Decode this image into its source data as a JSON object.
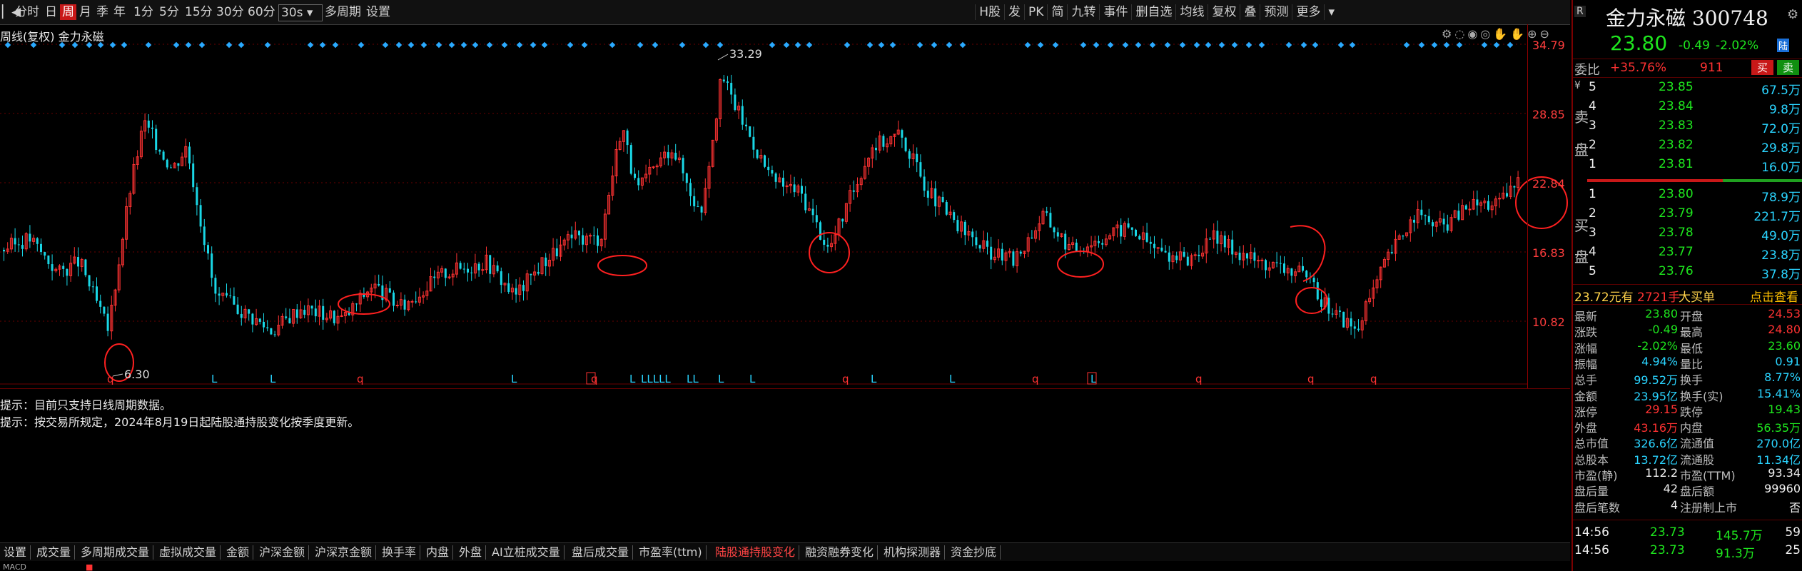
{
  "toolbar": {
    "periods": [
      "分时",
      "日",
      "周",
      "月",
      "季",
      "年",
      "1分",
      "5分",
      "15分",
      "30分",
      "60分",
      "30s",
      "多周期",
      "设置"
    ],
    "active_period": "周",
    "right_tools": [
      "H股",
      "发",
      "PK",
      "简",
      "九转",
      "事件",
      "删自选",
      "均线",
      "复权",
      "叠",
      "预测",
      "更多"
    ]
  },
  "chart": {
    "title": "周线(复权)",
    "stock": "金力永磁",
    "y_labels": [
      "34.79",
      "28.85",
      "22.84",
      "16.83",
      "10.82"
    ],
    "high_marker": "33.29",
    "low_marker": "6.30",
    "signal_row": [
      "q",
      "L",
      "L",
      "q",
      "L",
      "q",
      "L",
      "LLLLL",
      "LL",
      "L",
      "L",
      "q",
      "L",
      "L",
      "q",
      "L",
      "q",
      "q",
      "q"
    ]
  },
  "messages": [
    "提示：目前只支持日线周期数据。",
    "提示：按交易所规定，2024年8月19日起陆股通持股变化按季度更新。"
  ],
  "bottom_tabs": [
    "设置",
    "成交量",
    "多周期成交量",
    "虚拟成交量",
    "金额",
    "沪深金额",
    "沪深京金额",
    "换手率",
    "内盘",
    "外盘",
    "AI立桩成交量",
    "盘后成交量",
    "市盈率(ttm)",
    "陆股通持股变化",
    "融资融券变化",
    "机构探测器",
    "资金抄底"
  ],
  "active_tab": "陆股通持股变化",
  "quote": {
    "name": "金力永磁",
    "code": "300748",
    "price": "23.80",
    "change": "-0.49",
    "change_pct": "-2.02%",
    "tag": "陆",
    "weibi_label": "委比",
    "weibi": "+35.76%",
    "weicha": "911",
    "buy_btn": "买",
    "sell_btn": "卖",
    "sell_side_label": [
      "卖",
      "盘"
    ],
    "buy_side_label": [
      "买",
      "盘"
    ],
    "asks": [
      {
        "level": "5",
        "price": "23.85",
        "vol": "67.5万"
      },
      {
        "level": "4",
        "price": "23.84",
        "vol": "9.8万"
      },
      {
        "level": "3",
        "price": "23.83",
        "vol": "72.0万"
      },
      {
        "level": "2",
        "price": "23.82",
        "vol": "29.8万"
      },
      {
        "level": "1",
        "price": "23.81",
        "vol": "16.0万"
      }
    ],
    "bids": [
      {
        "level": "1",
        "price": "23.80",
        "vol": "78.9万"
      },
      {
        "level": "2",
        "price": "23.79",
        "vol": "221.7万"
      },
      {
        "level": "3",
        "price": "23.78",
        "vol": "49.0万"
      },
      {
        "level": "4",
        "price": "23.77",
        "vol": "23.8万"
      },
      {
        "level": "5",
        "price": "23.76",
        "vol": "37.8万"
      }
    ],
    "big_order": {
      "price": "23.72元有",
      "vol": "2721手",
      "label": "大买单",
      "link": "点击查看"
    },
    "stats": [
      [
        "最新",
        "23.80",
        "开盘",
        "24.53"
      ],
      [
        "涨跌",
        "-0.49",
        "最高",
        "24.80"
      ],
      [
        "涨幅",
        "-2.02%",
        "最低",
        "23.60"
      ],
      [
        "振幅",
        "4.94%",
        "量比",
        "0.91"
      ],
      [
        "总手",
        "99.52万",
        "换手",
        "8.77%"
      ],
      [
        "金额",
        "23.95亿",
        "换手(实)",
        "15.41%"
      ],
      [
        "涨停",
        "29.15",
        "跌停",
        "19.43"
      ],
      [
        "外盘",
        "43.16万",
        "内盘",
        "56.35万"
      ],
      [
        "总市值",
        "326.6亿",
        "流通值",
        "270.0亿"
      ],
      [
        "总股本",
        "13.72亿",
        "流通股",
        "11.34亿"
      ],
      [
        "市盈(静)",
        "112.2",
        "市盈(TTM)",
        "93.34"
      ],
      [
        "盘后量",
        "42",
        "盘后额",
        "99960"
      ],
      [
        "盘后笔数",
        "4",
        "注册制上市",
        "否"
      ]
    ],
    "ticks": [
      [
        "14:56",
        "23.73",
        "145.7万",
        "59"
      ],
      [
        "14:56",
        "23.73",
        "91.3万",
        "25"
      ]
    ]
  }
}
